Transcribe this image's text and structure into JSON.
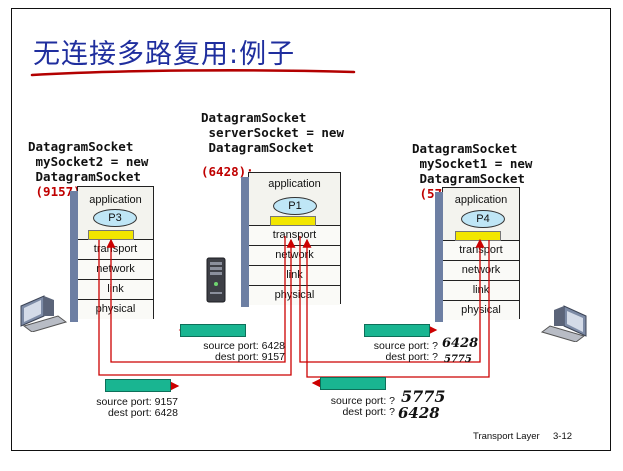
{
  "slide": {
    "title": "无连接多路复用:例子",
    "footer": "Transport Layer",
    "page_num": "3-12"
  },
  "code": {
    "server": [
      "DatagramSocket",
      " serverSocket = new",
      " DatagramSocket"
    ],
    "server_port": "(6428);",
    "client_left": [
      "DatagramSocket",
      " mySocket2 = new",
      " DatagramSocket"
    ],
    "client_left_port": " (9157);",
    "client_right": [
      "DatagramSocket",
      " mySocket1 = new",
      " DatagramSocket"
    ],
    "client_right_port": " (5775);"
  },
  "stacks": {
    "labels": [
      "application",
      "transport",
      "network",
      "link",
      "physical"
    ],
    "left_process": "P3",
    "center_process": "P1",
    "right_process": "P4"
  },
  "segments": {
    "top_left": {
      "source": "source port: 6428",
      "dest": "dest port: 9157"
    },
    "top_right": {
      "source": "source port: ?",
      "dest": "dest port: ?",
      "hand_source": "6428",
      "hand_dest": "5775"
    },
    "bottom_left": {
      "source": "source port: 9157",
      "dest": "dest port: 6428"
    },
    "bottom_right": {
      "source": "source port: ?",
      "dest": "dest port: ?",
      "hand_source": "5775",
      "hand_dest": "6428"
    }
  },
  "colors": {
    "title": "#1f2e9e",
    "port_number": "#c00000",
    "arrow": "#cc0000",
    "segment": "#19b591",
    "socket": "#f2e600",
    "process": "#bfe6f6"
  }
}
